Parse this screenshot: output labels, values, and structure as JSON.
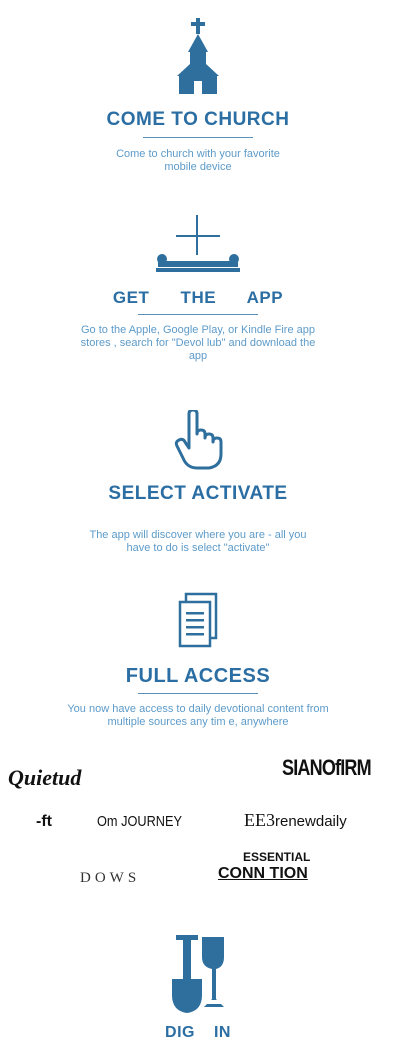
{
  "steps": [
    {
      "title": "COME TO CHURCH",
      "description": "Come to church with your favorite mobile device",
      "icon": "church-icon"
    },
    {
      "title": "GET THE APP",
      "description": "Go to the Apple, Google Play, or Kindle Fire app stores , search for \"Devol lub\" and download the app",
      "icon": "plus-scroll-icon"
    },
    {
      "title": "SELECT ACTIVATE",
      "description": "The app will discover where you are - all you have to do is select \"activate\"",
      "icon": "pointing-hand-icon"
    },
    {
      "title": "FULL ACCESS",
      "description": "You now have access to daily devotional content from multiple sources any tim e, anywhere",
      "icon": "documents-icon"
    },
    {
      "title": "DIG IN",
      "description": "",
      "icon": "shovel-icon"
    }
  ],
  "partner_logos": {
    "quietud": "Quietud",
    "sianofirm": "SIANOfIRM",
    "ft": "-ft",
    "om_journey": "Om JOURNEY",
    "renew_prefix": "EE3",
    "renew_text": "renewdaily",
    "essential": "ESSENTIAL",
    "connection": "CONN TION",
    "dows": "DOWS"
  },
  "colors": {
    "title": "#2b6ea3",
    "description": "#5d9bc9",
    "icon": "#2e6f9e"
  }
}
